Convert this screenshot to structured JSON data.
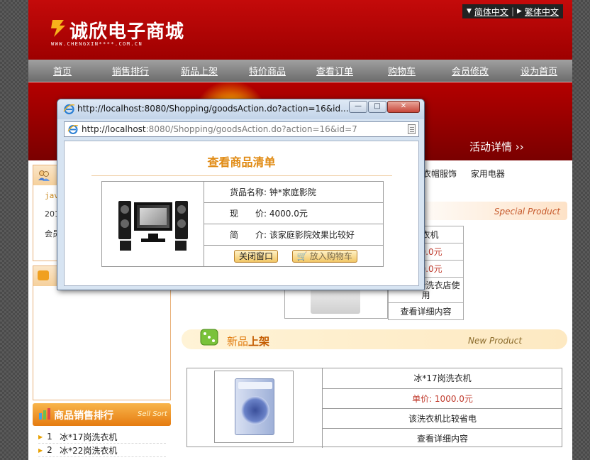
{
  "header": {
    "logo_text": "诚欣电子商城",
    "logo_sub": "WWW.CHENGXIN****.COM.CN",
    "lang_simplified": "简体中文",
    "lang_traditional": "繁体中文"
  },
  "nav": {
    "items": [
      "首页",
      "销售排行",
      "新品上架",
      "特价商品",
      "查看订单",
      "购物车",
      "会员修改",
      "设为首页"
    ]
  },
  "banner": {
    "activity_text": "活动详情 ››"
  },
  "sidebar": {
    "user_lines": [
      "jav",
      "201",
      "会员"
    ],
    "sales_title": "商品销售排行",
    "sales_en": "Sell Sort",
    "rank_items": [
      {
        "num": "1",
        "name": "冰*17岗洗衣机"
      },
      {
        "num": "2",
        "name": "冰*22岗洗衣机"
      }
    ]
  },
  "main": {
    "categories": [
      "衣帽服饰",
      "家用电器"
    ],
    "special_en": "Special Product",
    "special_product": {
      "name": "洗衣机",
      "price": "000.0元",
      "price2": "000.0元",
      "desc": "比较适合洗衣店使用",
      "detail": "查看详细内容"
    },
    "new_title_a": "新品",
    "new_title_b": "上架",
    "new_en": "New Product",
    "new_product": {
      "name": "冰*17岗洗衣机",
      "price": "单价: 1000.0元",
      "desc": "该洗衣机比较省电",
      "detail": "查看详细内容"
    }
  },
  "popup": {
    "window_title": "http://localhost:8080/Shopping/goodsAction.do?action=16&id...",
    "address_host": "http://localhost",
    "address_rest": ":8080/Shopping/goodsAction.do?action=16&id=7",
    "heading": "查看商品清单",
    "goods_name": "货品名称: 钟*家庭影院",
    "price": "现　　价: 4000.0元",
    "intro": "简　　介: 该家庭影院效果比较好",
    "close_button": "关闭窗口",
    "cart_button": "放入购物车"
  },
  "colors": {
    "header_red": "#b40000",
    "accent_orange": "#e08a12",
    "price_red": "#c0392b"
  }
}
